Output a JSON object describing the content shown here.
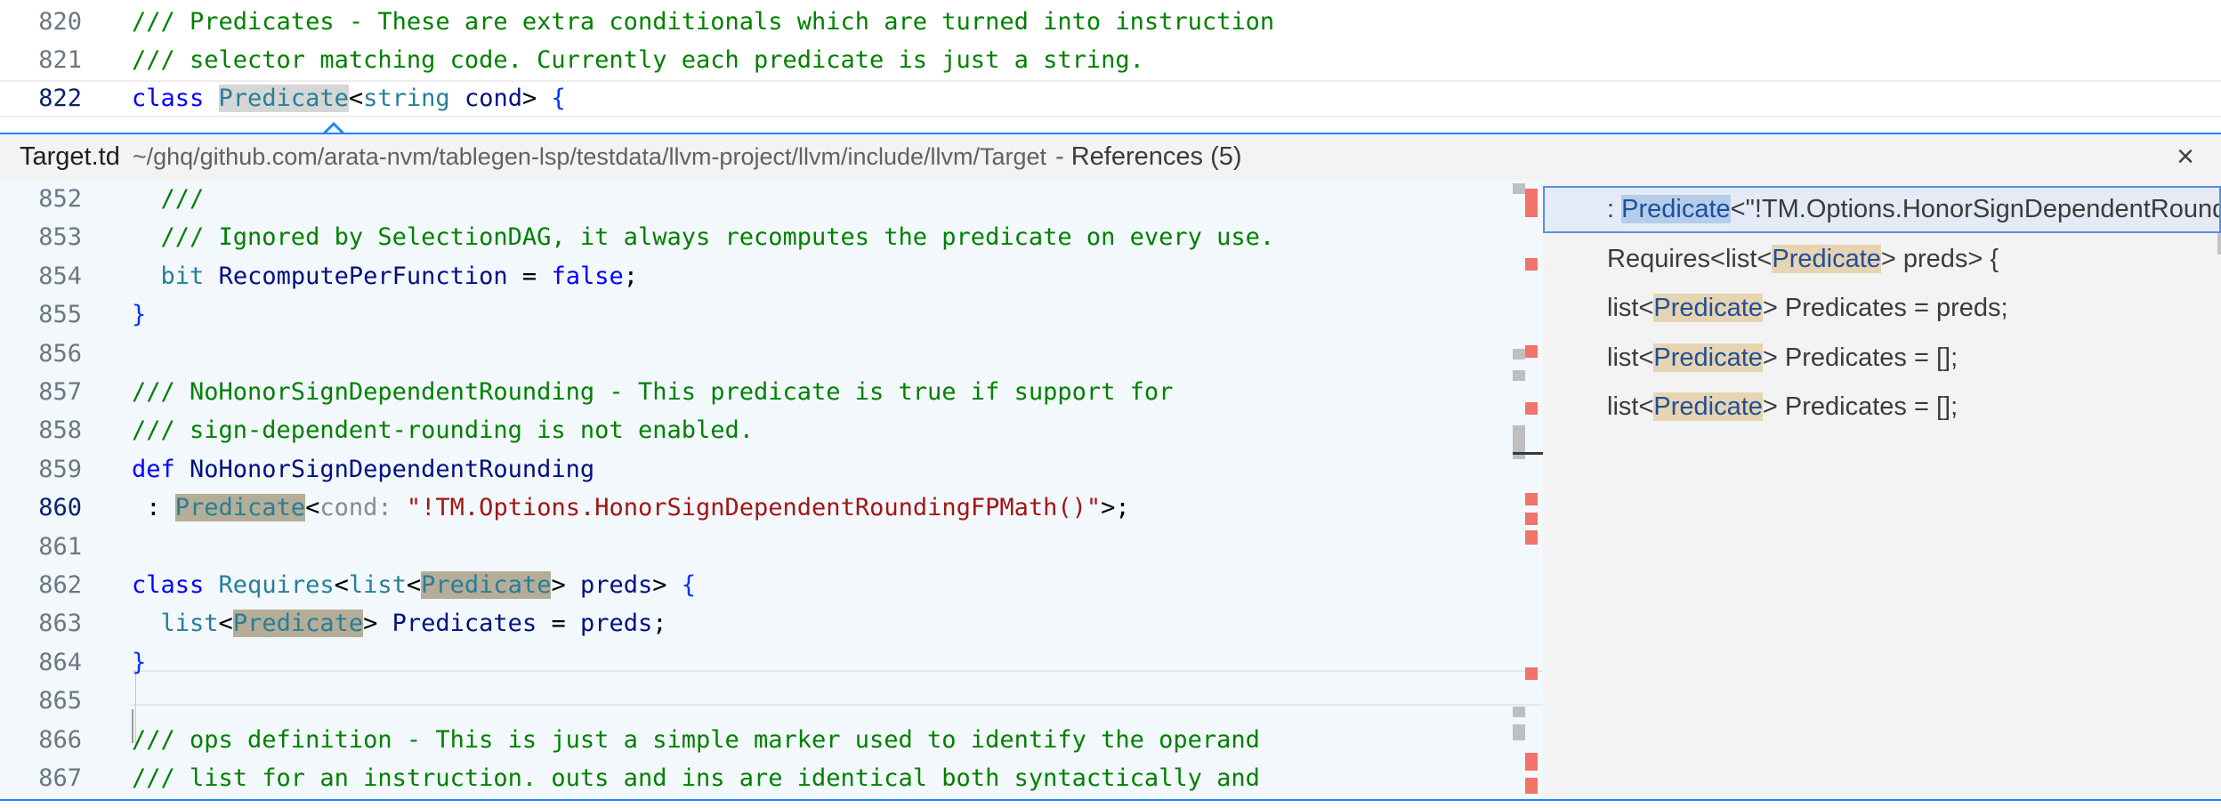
{
  "top_editor": {
    "lines": [
      {
        "num": "820",
        "tokens": [
          {
            "t": "/// Predicates - These are extra conditionals which are turned into instruction",
            "c": "com"
          }
        ]
      },
      {
        "num": "821",
        "tokens": [
          {
            "t": "/// selector matching code. Currently each predicate is just a string.",
            "c": "com"
          }
        ]
      },
      {
        "num": "822",
        "tokens": [
          {
            "t": "class ",
            "c": "kw"
          },
          {
            "t": "Predicate",
            "c": "type",
            "h": "hl"
          },
          {
            "t": "<",
            "c": "plain"
          },
          {
            "t": "string",
            "c": "type"
          },
          {
            "t": " ",
            "c": "plain"
          },
          {
            "t": "cond",
            "c": "id"
          },
          {
            "t": "> ",
            "c": "plain"
          },
          {
            "t": "{",
            "c": "br"
          }
        ]
      }
    ]
  },
  "peek": {
    "file_name": "Target.td",
    "file_path": "~/ghq/github.com/arata-nvm/tablegen-lsp/testdata/llvm-project/llvm/include/llvm/Target",
    "separator": "-",
    "title": "References (5)",
    "close_icon": "×",
    "accent_color": "#1a85ff"
  },
  "peek_editor": {
    "lines": [
      {
        "num": "852",
        "tokens": [
          {
            "t": "  ///",
            "c": "com"
          }
        ]
      },
      {
        "num": "853",
        "tokens": [
          {
            "t": "  /// Ignored by SelectionDAG, it always recomputes the predicate on every use.",
            "c": "com"
          }
        ]
      },
      {
        "num": "854",
        "tokens": [
          {
            "t": "  ",
            "c": "plain"
          },
          {
            "t": "bit",
            "c": "type"
          },
          {
            "t": " ",
            "c": "plain"
          },
          {
            "t": "RecomputePerFunction",
            "c": "id"
          },
          {
            "t": " = ",
            "c": "plain"
          },
          {
            "t": "false",
            "c": "kw"
          },
          {
            "t": ";",
            "c": "plain"
          }
        ]
      },
      {
        "num": "855",
        "tokens": [
          {
            "t": "}",
            "c": "br"
          }
        ]
      },
      {
        "num": "856",
        "tokens": []
      },
      {
        "num": "857",
        "tokens": [
          {
            "t": "/// NoHonorSignDependentRounding - This predicate is true if support for",
            "c": "com"
          }
        ]
      },
      {
        "num": "858",
        "tokens": [
          {
            "t": "/// sign-dependent-rounding is not enabled.",
            "c": "com"
          }
        ]
      },
      {
        "num": "859",
        "tokens": [
          {
            "t": "def ",
            "c": "kw"
          },
          {
            "t": "NoHonorSignDependentRounding",
            "c": "id"
          }
        ]
      },
      {
        "num": "860",
        "tokens": [
          {
            "t": " : ",
            "c": "plain"
          },
          {
            "t": "Predicate",
            "c": "type",
            "h": "hl-strong"
          },
          {
            "t": "<",
            "c": "plain"
          },
          {
            "t": "cond:",
            "c": "hint"
          },
          {
            "t": " ",
            "c": "plain"
          },
          {
            "t": "\"!TM.Options.HonorSignDependentRoundingFPMath()\"",
            "c": "str"
          },
          {
            "t": ">;",
            "c": "plain"
          }
        ]
      },
      {
        "num": "861",
        "tokens": []
      },
      {
        "num": "862",
        "tokens": [
          {
            "t": "class ",
            "c": "kw"
          },
          {
            "t": "Requires",
            "c": "type"
          },
          {
            "t": "<",
            "c": "plain"
          },
          {
            "t": "list",
            "c": "type"
          },
          {
            "t": "<",
            "c": "plain"
          },
          {
            "t": "Predicate",
            "c": "type",
            "h": "hl-strong"
          },
          {
            "t": "> ",
            "c": "plain"
          },
          {
            "t": "preds",
            "c": "id"
          },
          {
            "t": "> ",
            "c": "plain"
          },
          {
            "t": "{",
            "c": "br"
          }
        ]
      },
      {
        "num": "863",
        "tokens": [
          {
            "t": "  ",
            "c": "plain"
          },
          {
            "t": "list",
            "c": "type"
          },
          {
            "t": "<",
            "c": "plain"
          },
          {
            "t": "Predicate",
            "c": "type",
            "h": "hl-strong"
          },
          {
            "t": "> ",
            "c": "plain"
          },
          {
            "t": "Predicates",
            "c": "id"
          },
          {
            "t": " = ",
            "c": "plain"
          },
          {
            "t": "preds",
            "c": "id"
          },
          {
            "t": ";",
            "c": "plain"
          }
        ]
      },
      {
        "num": "864",
        "tokens": [
          {
            "t": "}",
            "c": "br"
          }
        ]
      },
      {
        "num": "865",
        "tokens": []
      },
      {
        "num": "866",
        "tokens": [
          {
            "t": "/// ops definition - This is just a simple marker used to identify the operand",
            "c": "com"
          }
        ]
      },
      {
        "num": "867",
        "tokens": [
          {
            "t": "/// list for an instruction. outs and ins are identical both syntactically and",
            "c": "com"
          }
        ]
      }
    ],
    "active_line": "860"
  },
  "references": {
    "items": [
      {
        "pre": ": ",
        "match": "Predicate",
        "post": "<\"!TM.Options.HonorSignDependentRoundingFPMath()\">;",
        "selected": true
      },
      {
        "pre": "Requires<list<",
        "match": "Predicate",
        "post": "> preds> {",
        "selected": false
      },
      {
        "pre": "list<",
        "match": "Predicate",
        "post": "> Predicates = preds;",
        "selected": false
      },
      {
        "pre": "list<",
        "match": "Predicate",
        "post": "> Predicates = [];",
        "selected": false
      },
      {
        "pre": "list<",
        "match": "Predicate",
        "post": "> Predicates = [];",
        "selected": false
      }
    ]
  }
}
